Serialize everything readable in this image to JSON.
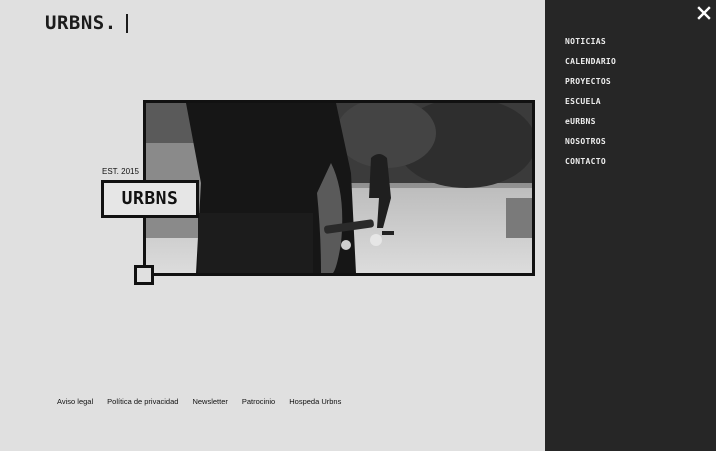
{
  "header": {
    "logo": "URBNS."
  },
  "hero": {
    "est_label": "EST. 2015",
    "badge_text": "URBNS"
  },
  "footer": {
    "links": [
      "Aviso legal",
      "Política de privacidad",
      "Newsletter",
      "Patrocinio",
      "Hospeda Urbns"
    ]
  },
  "menu": {
    "items": [
      "NOTICIAS",
      "CALENDARIO",
      "PROYECTOS",
      "ESCUELA",
      "eURBNS",
      "NOSOTROS",
      "CONTACTO"
    ]
  },
  "icons": {
    "close": "close-icon"
  }
}
